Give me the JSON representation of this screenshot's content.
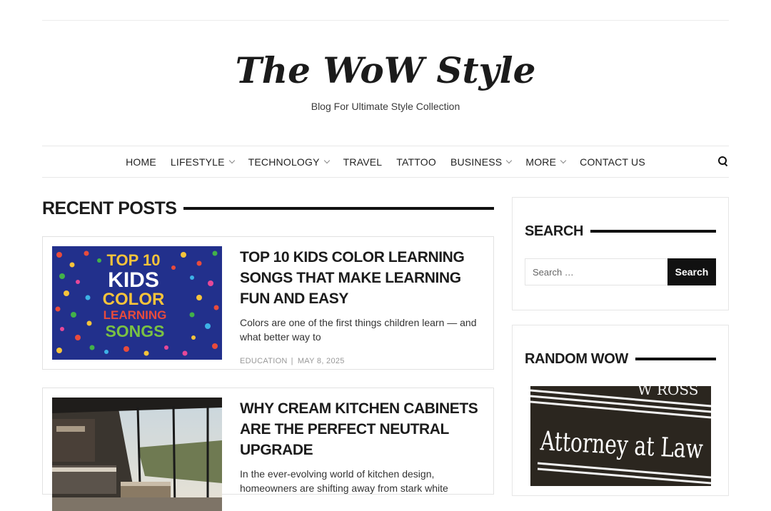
{
  "site": {
    "title": "The WoW Style",
    "tagline": "Blog For Ultimate Style Collection"
  },
  "nav": {
    "items": [
      {
        "label": "HOME",
        "has_submenu": false
      },
      {
        "label": "LIFESTYLE",
        "has_submenu": true
      },
      {
        "label": "TECHNOLOGY",
        "has_submenu": true
      },
      {
        "label": "TRAVEL",
        "has_submenu": false
      },
      {
        "label": "TATTOO",
        "has_submenu": false
      },
      {
        "label": "BUSINESS",
        "has_submenu": true
      },
      {
        "label": "MORE",
        "has_submenu": true
      },
      {
        "label": "CONTACT US",
        "has_submenu": false
      }
    ],
    "search_icon": "search-icon"
  },
  "recent": {
    "heading": "RECENT POSTS",
    "posts": [
      {
        "title": "TOP 10 KIDS COLOR LEARNING SONGS THAT MAKE LEARNING FUN AND EASY",
        "excerpt": "Colors are one of the first things children learn — and what better way to",
        "category": "EDUCATION",
        "date": "MAY 8, 2025",
        "thumb_text": [
          "TOP 10",
          "KIDS",
          "COLOR",
          "LEARNING",
          "SONGS"
        ]
      },
      {
        "title": "WHY CREAM KITCHEN CABINETS ARE THE PERFECT NEUTRAL UPGRADE",
        "excerpt": "In the ever-evolving world of kitchen design, homeowners are shifting away from stark white"
      }
    ]
  },
  "sidebar": {
    "search": {
      "heading": "SEARCH",
      "placeholder": "Search …",
      "button": "Search"
    },
    "random": {
      "heading": "RANDOM WOW",
      "image_text": "Attorney at Law",
      "image_top_text": "W ROSS"
    }
  },
  "colors": {
    "accent": "#111111",
    "text": "#222222",
    "meta": "#999999",
    "thumb_navy": "#22308c"
  }
}
